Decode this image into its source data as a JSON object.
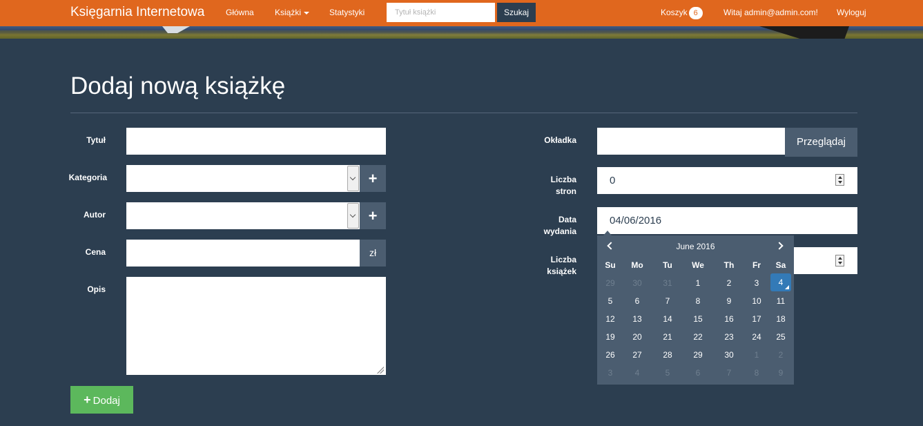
{
  "navbar": {
    "brand": "Księgarnia Internetowa",
    "links": {
      "home": "Główna",
      "books": "Książki",
      "stats": "Statystyki",
      "logout": "Wyloguj"
    },
    "search_placeholder": "Tytuł książki",
    "search_button": "Szukaj",
    "cart_label": "Koszyk",
    "cart_count": "6",
    "welcome": "Witaj admin@admin.com!"
  },
  "page": {
    "title": "Dodaj nową książkę"
  },
  "form": {
    "labels": {
      "title": "Tytuł",
      "category": "Kategoria",
      "author": "Autor",
      "price": "Cena",
      "description": "Opis",
      "cover": "Okładka",
      "pages_1": "Liczba",
      "pages_2": "stron",
      "date_1": "Data",
      "date_2": "wydania",
      "count_1": "Liczba",
      "count_2": "książek"
    },
    "currency": "zł",
    "add_icon": "+",
    "browse_button": "Przeglądaj",
    "pages_value": "0",
    "date_value": "04/06/2016",
    "submit_button": "Dodaj"
  },
  "datepicker": {
    "month_label": "June 2016",
    "weekdays": [
      "Su",
      "Mo",
      "Tu",
      "We",
      "Th",
      "Fr",
      "Sa"
    ],
    "weeks": [
      [
        "29",
        "30",
        "31",
        "1",
        "2",
        "3",
        "4"
      ],
      [
        "5",
        "6",
        "7",
        "8",
        "9",
        "10",
        "11"
      ],
      [
        "12",
        "13",
        "14",
        "15",
        "16",
        "17",
        "18"
      ],
      [
        "19",
        "20",
        "21",
        "22",
        "23",
        "24",
        "25"
      ],
      [
        "26",
        "27",
        "28",
        "29",
        "30",
        "1",
        "2"
      ],
      [
        "3",
        "4",
        "5",
        "6",
        "7",
        "8",
        "9"
      ]
    ],
    "selected_day": "4"
  },
  "colors": {
    "navbar": "#e0671e",
    "background": "#2c3e50",
    "addon": "#4b5d70",
    "success": "#5cb85c",
    "selected": "#337ab7"
  }
}
